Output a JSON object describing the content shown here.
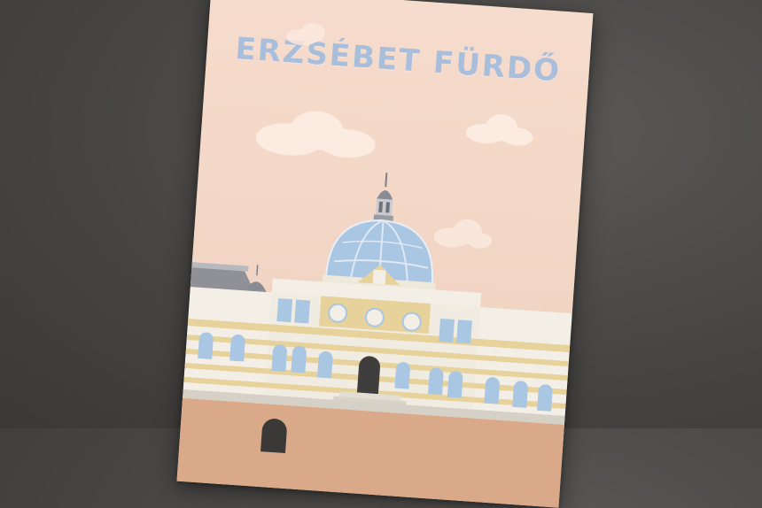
{
  "poster": {
    "title": "ERZSÉBET FÜRDŐ"
  },
  "colors": {
    "background": "#474644",
    "poster": "#f3d7c6",
    "title": "#a9bedb",
    "facade_yellow": "#e6d29a",
    "facade_white": "#f3efe6",
    "dome_glass": "#a9c6e3",
    "roof_gray": "#8f9197",
    "ground": "#d9a98a"
  },
  "icons": [
    "cloud-icon",
    "dome",
    "spire",
    "arched-door"
  ]
}
